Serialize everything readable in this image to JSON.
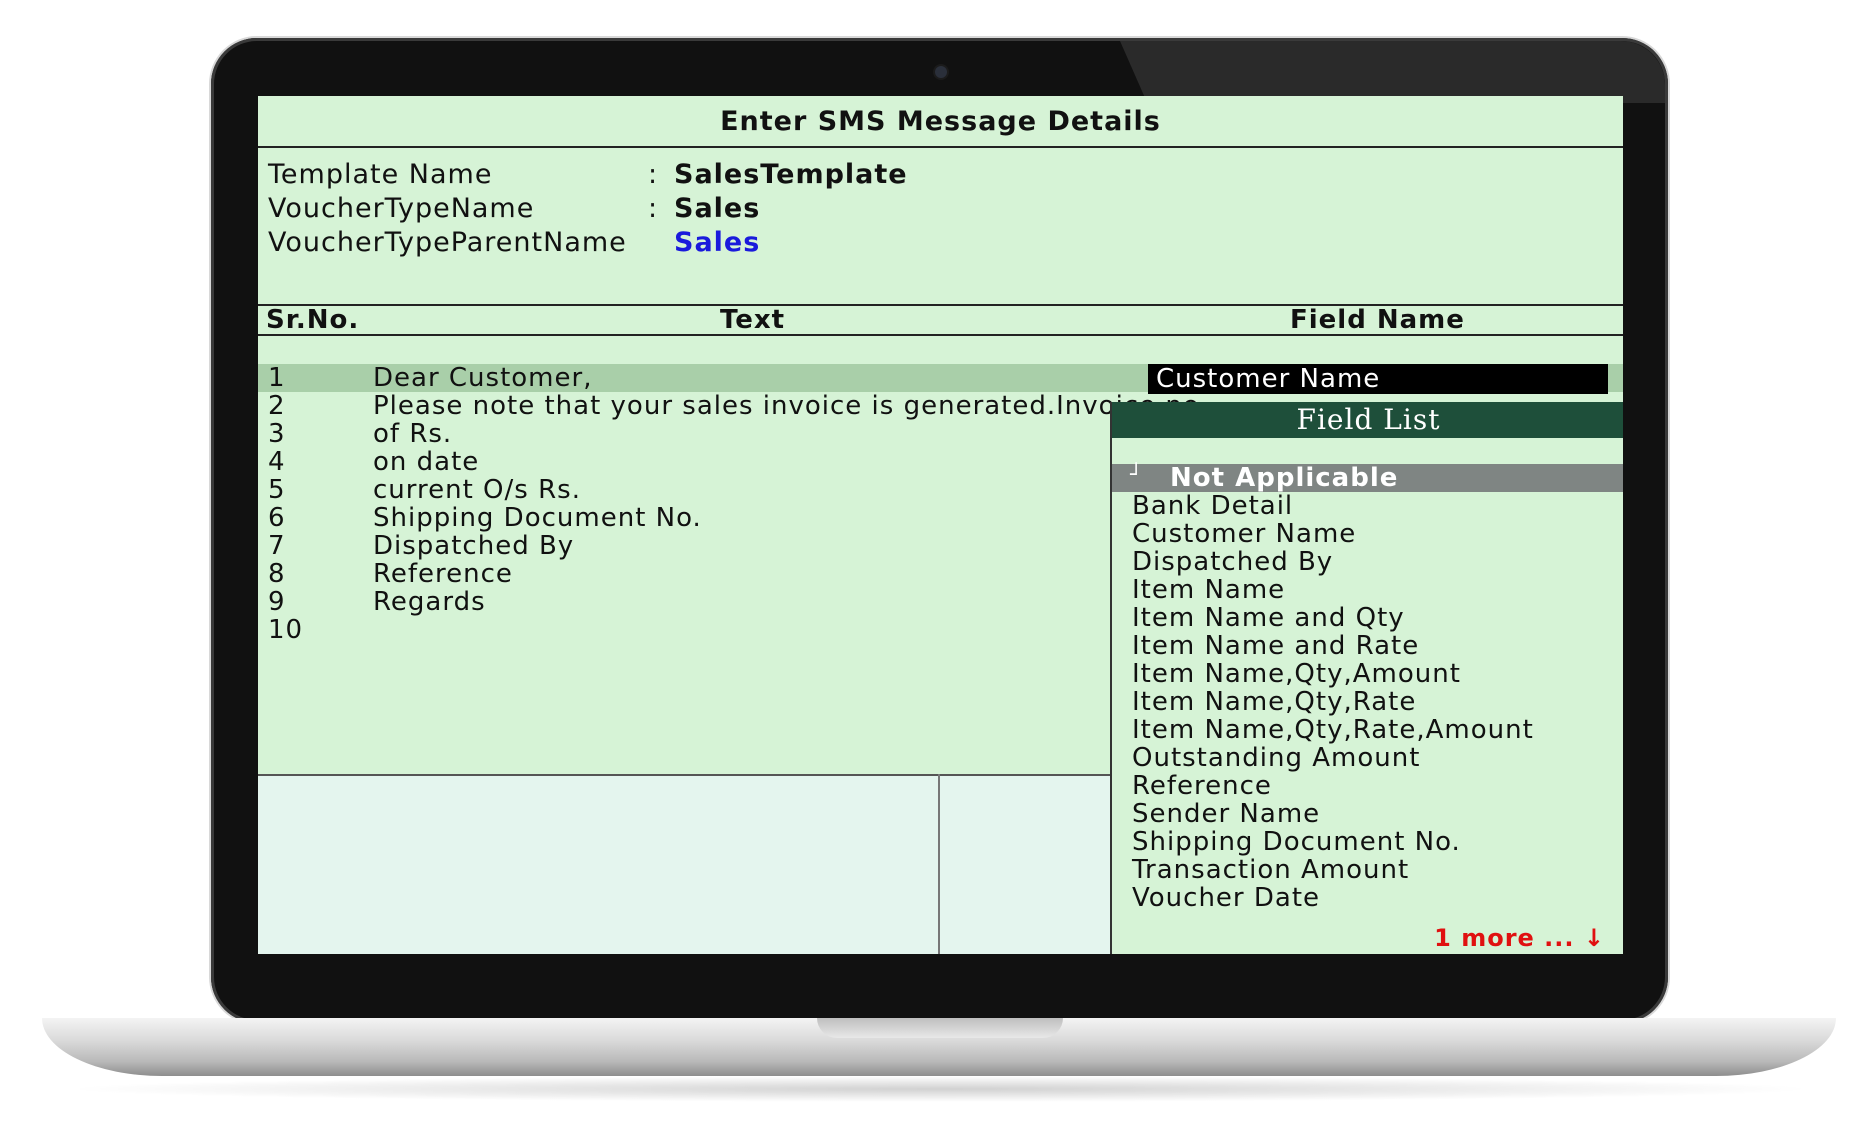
{
  "window": {
    "title": "Enter SMS Message Details"
  },
  "template": {
    "template_name_label": "Template Name",
    "template_name_value": "SalesTemplate",
    "voucher_type_label": "VoucherTypeName",
    "voucher_type_value": "Sales",
    "voucher_parent_label": "VoucherTypeParentName",
    "voucher_parent_value": "Sales",
    "colon": ":",
    "value_accent_color": "#1a1adc"
  },
  "table": {
    "headers": {
      "srno": "Sr.No.",
      "text": "Text",
      "field": "Field Name"
    },
    "rows": [
      {
        "no": "1",
        "text": "Dear Customer,"
      },
      {
        "no": "2",
        "text": "Please note that your sales invoice is generated.Invoice no."
      },
      {
        "no": "3",
        "text": "of  Rs."
      },
      {
        "no": "4",
        "text": "on date"
      },
      {
        "no": "5",
        "text": "current O/s  Rs."
      },
      {
        "no": "6",
        "text": "Shipping Document No."
      },
      {
        "no": "7",
        "text": "Dispatched By"
      },
      {
        "no": "8",
        "text": "Reference"
      },
      {
        "no": "9",
        "text": "Regards"
      },
      {
        "no": "10",
        "text": ""
      }
    ],
    "selected_field": "Customer Name"
  },
  "field_list": {
    "title": "Field List",
    "selected": "Not Applicable",
    "selected_mark": "┘",
    "items": [
      "Bank Detail",
      "Customer Name",
      "Dispatched By",
      "Item Name",
      "Item Name and Qty",
      "Item Name and Rate",
      "Item Name,Qty,Amount",
      "Item Name,Qty,Rate",
      "Item Name,Qty,Rate,Amount",
      "Outstanding Amount",
      "Reference",
      "Sender Name",
      "Shipping Document No.",
      "Transaction Amount",
      "Voucher Date"
    ],
    "more": "1 more ... ↓",
    "header_color": "#1e4f3a",
    "more_color": "#e01010"
  },
  "colors": {
    "screen_bg": "#d6f3d6",
    "row_highlight": "#a9cfa9"
  }
}
